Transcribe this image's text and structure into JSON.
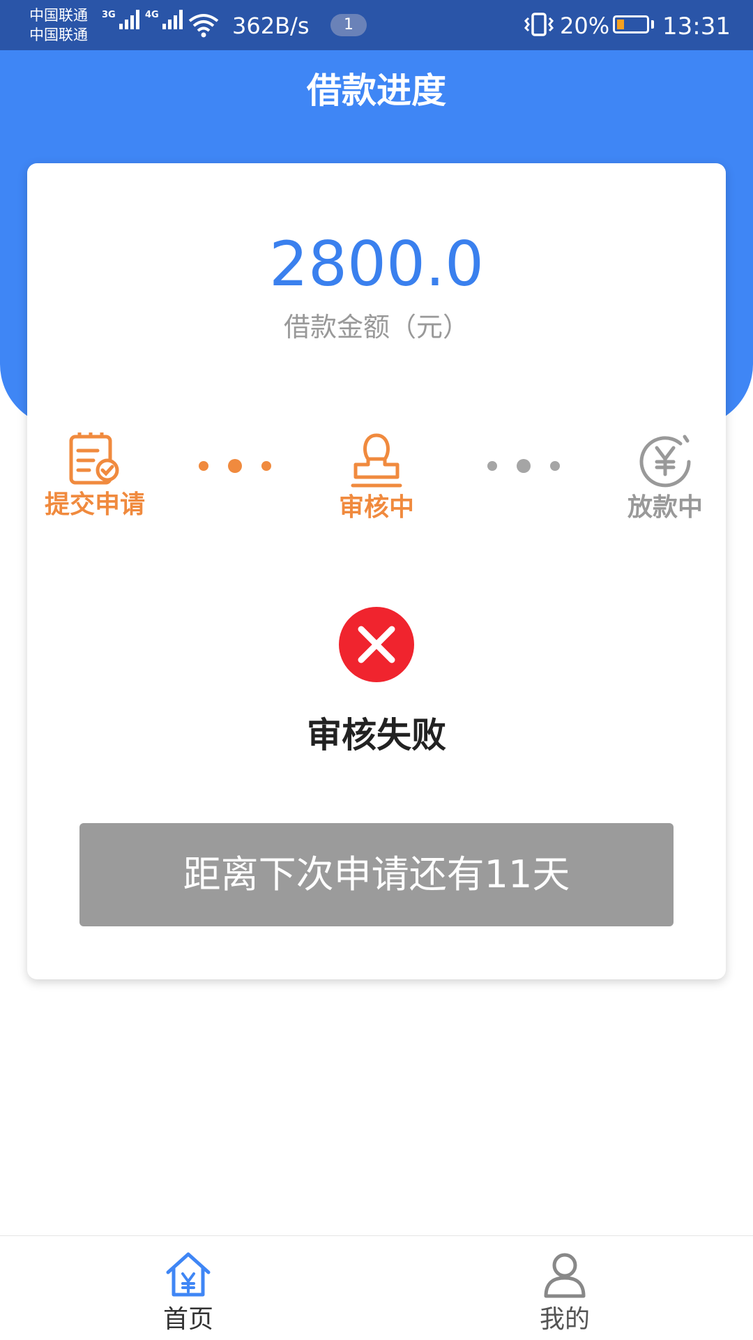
{
  "status_bar": {
    "carrier_1": "中国联通",
    "carrier_2": "中国联通",
    "network_1": "3G",
    "network_2": "4G",
    "speed": "362B/s",
    "notification_count": "1",
    "battery": "20%",
    "battery_level": 0.2,
    "time": "13:31"
  },
  "header": {
    "title": "借款进度"
  },
  "loan": {
    "amount": "2800.0",
    "amount_label": "借款金额（元）"
  },
  "progress": {
    "steps": [
      {
        "label": "提交申请",
        "icon": "document-check-icon",
        "state": "done"
      },
      {
        "label": "审核中",
        "icon": "stamp-icon",
        "state": "active"
      },
      {
        "label": "放款中",
        "icon": "yuan-coin-icon",
        "state": "pending"
      }
    ]
  },
  "result": {
    "status_text": "审核失败",
    "icon": "error-x-icon"
  },
  "action": {
    "next_apply_label": "距离下次申请还有11天"
  },
  "bottom_nav": {
    "items": [
      {
        "label": "首页",
        "icon": "home-yuan-icon",
        "active": true
      },
      {
        "label": "我的",
        "icon": "user-icon",
        "active": false
      }
    ]
  },
  "colors": {
    "status_bar": "#2a55a8",
    "header": "#3f86f5",
    "amount": "#3a80ee",
    "step_active": "#f08a3e",
    "step_pending": "#999999",
    "error": "#f0242e",
    "button_disabled": "#9b9b9b"
  }
}
